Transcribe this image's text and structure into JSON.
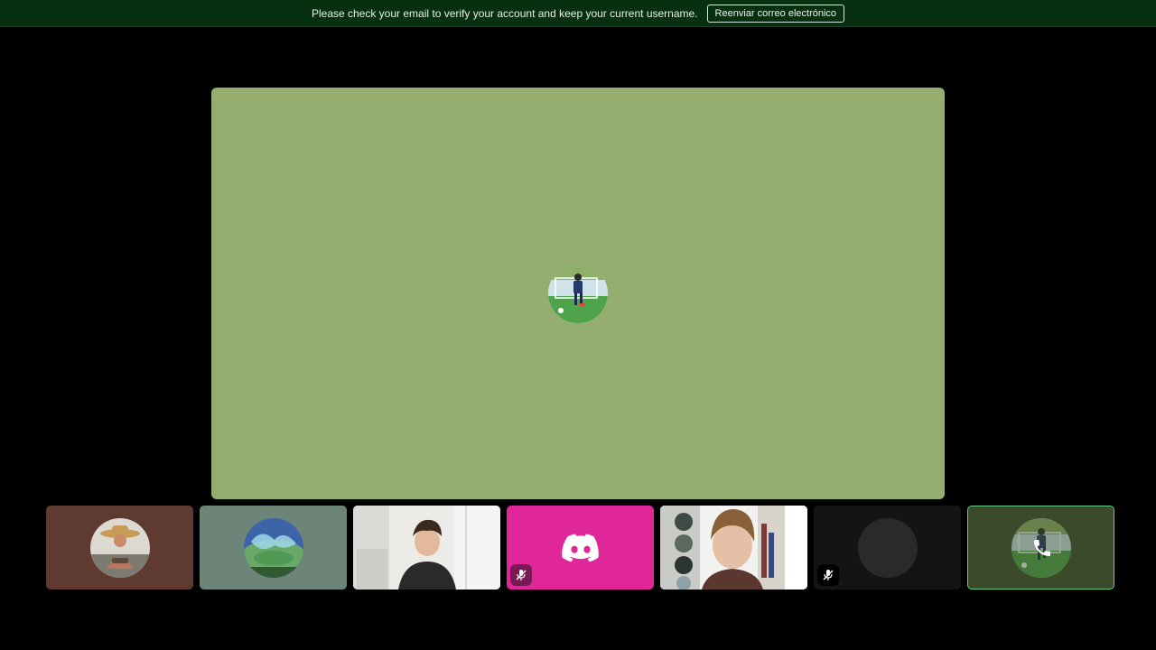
{
  "banner": {
    "message": "Please check your email to verify your account and keep your current username.",
    "button_label": "Reenviar correo electrónico"
  },
  "stage": {
    "background": "#95ae6f",
    "avatar_icon": "soccer-player-photo"
  },
  "tiles": [
    {
      "kind": "avatar",
      "background": "#5e3a30",
      "avatar_icon": "person-straw-hat-photo"
    },
    {
      "kind": "avatar",
      "background": "#6d8479",
      "avatar_icon": "stadium-photo"
    },
    {
      "kind": "camera",
      "background": "#e8e6e2",
      "avatar_icon": "webcam-boy-dark-hair"
    },
    {
      "kind": "logo",
      "background": "#e0279a",
      "avatar_icon": "discord-logo-icon",
      "muted": true
    },
    {
      "kind": "camera",
      "background": "#f1f1f1",
      "avatar_icon": "webcam-boy-brown-hair"
    },
    {
      "kind": "empty",
      "background": "#141414",
      "avatar_icon": "blank-avatar",
      "muted": true
    },
    {
      "kind": "avatar",
      "background": "#3a4a2a",
      "avatar_icon": "soccer-player-photo",
      "overlay_icon": "phone-icon",
      "selected": true,
      "accent": "#63d08a"
    }
  ]
}
